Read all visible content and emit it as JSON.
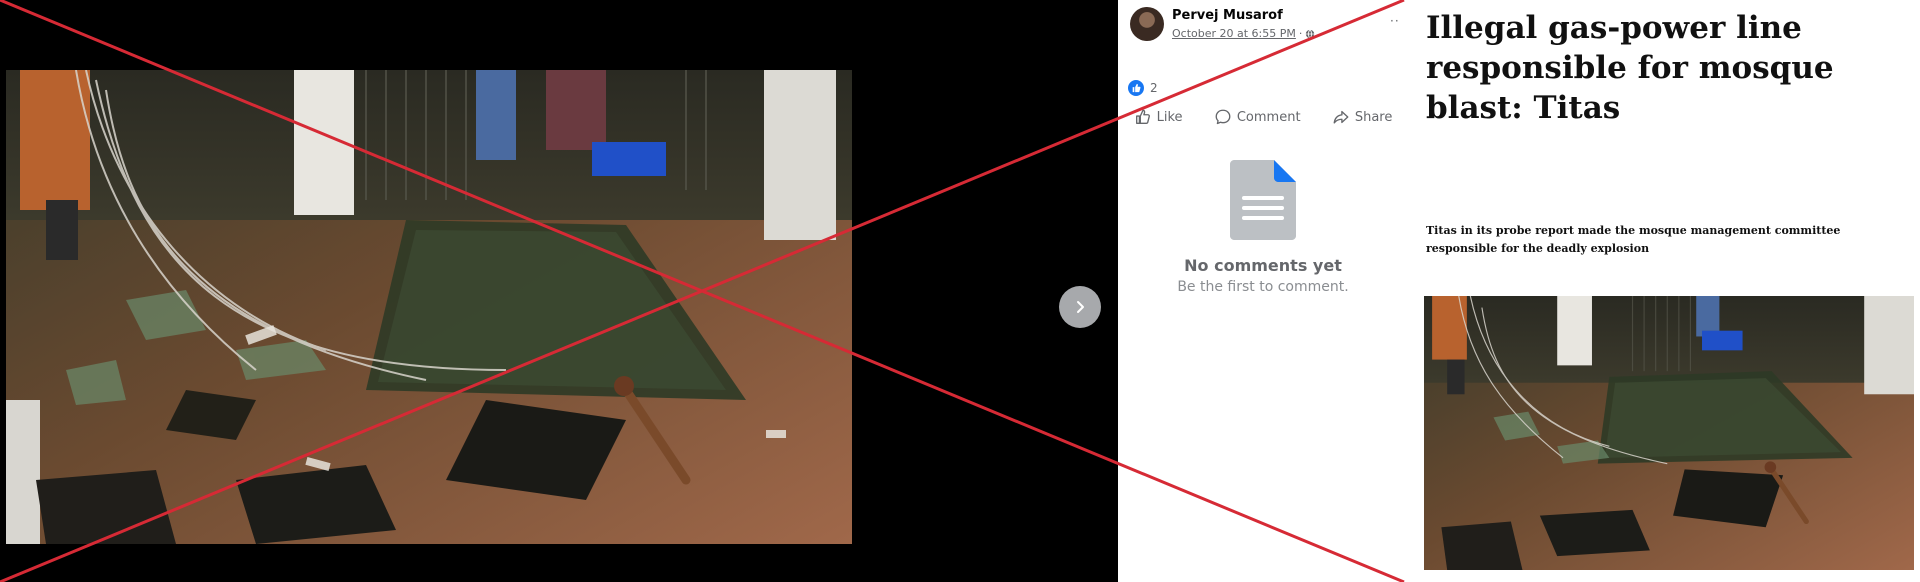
{
  "post": {
    "author": "Pervej Musarof",
    "date": "October 20 at 6:55 PM",
    "separator": "·",
    "reaction_count": "2",
    "actions": {
      "like": "Like",
      "comment": "Comment",
      "share": "Share"
    },
    "empty_comments": {
      "title": "No comments yet",
      "subtitle": "Be the first to comment."
    },
    "more_menu": "··"
  },
  "article": {
    "headline": "Illegal gas-power line responsible for mosque blast: Titas",
    "summary": "Titas in its probe report made the mosque management committee responsible for the deadly explosion"
  },
  "icons": {
    "next": "chevron-right-icon",
    "globe": "globe-icon",
    "like_badge": "thumbs-up-icon",
    "like": "thumbs-up-icon",
    "comment": "speech-bubble-icon",
    "share": "share-arrow-icon",
    "no_comments": "document-icon",
    "overlay": "red-cross-mark"
  },
  "colors": {
    "facebook_blue": "#1877f2",
    "cross_red": "#d62a35",
    "muted_text": "#65676b"
  }
}
